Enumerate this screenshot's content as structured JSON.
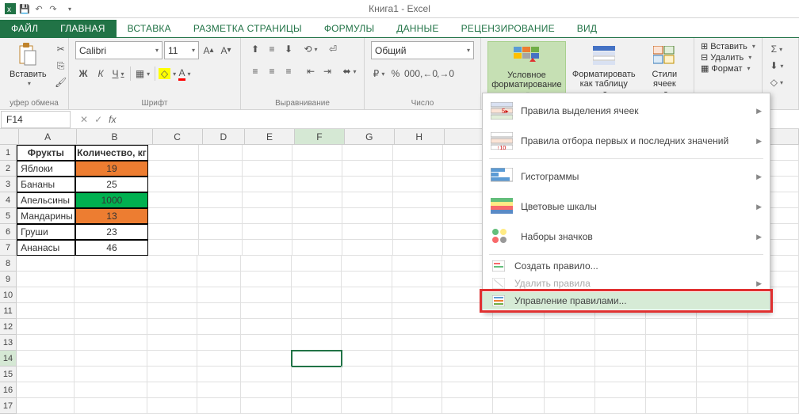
{
  "app_title": "Книга1 - Excel",
  "tabs": {
    "file": "ФАЙЛ",
    "home": "ГЛАВНАЯ",
    "insert": "ВСТАВКА",
    "layout": "РАЗМЕТКА СТРАНИЦЫ",
    "formulas": "ФОРМУЛЫ",
    "data": "ДАННЫЕ",
    "review": "РЕЦЕНЗИРОВАНИЕ",
    "view": "ВИД"
  },
  "ribbon": {
    "clipboard": {
      "paste": "Вставить",
      "label": "уфер обмена"
    },
    "font": {
      "name": "Calibri",
      "size": "11",
      "label": "Шрифт"
    },
    "alignment": {
      "label": "Выравнивание"
    },
    "number": {
      "format": "Общий",
      "label": "Число"
    },
    "styles": {
      "cond_format": "Условное\nформатирование",
      "format_table": "Форматировать\nкак таблицу",
      "cell_styles": "Стили\nячеек"
    },
    "cells": {
      "insert": "Вставить",
      "delete": "Удалить",
      "format": "Формат"
    }
  },
  "namebox": "F14",
  "columns": [
    "A",
    "B",
    "C",
    "D",
    "E",
    "F",
    "G",
    "H"
  ],
  "table": {
    "headers": [
      "Фрукты",
      "Количество, кг"
    ],
    "rows": [
      {
        "name": "Яблоки",
        "qty": "19",
        "color": "orange"
      },
      {
        "name": "Бананы",
        "qty": "25",
        "color": ""
      },
      {
        "name": "Апельсины",
        "qty": "1000",
        "color": "green"
      },
      {
        "name": "Мандарины",
        "qty": "13",
        "color": "orange"
      },
      {
        "name": "Груши",
        "qty": "23",
        "color": ""
      },
      {
        "name": "Ананасы",
        "qty": "46",
        "color": ""
      }
    ]
  },
  "dropdown": {
    "highlight_rules": "Правила выделения ячеек",
    "top_bottom": "Правила отбора первых и последних значений",
    "data_bars": "Гистограммы",
    "color_scales": "Цветовые шкалы",
    "icon_sets": "Наборы значков",
    "new_rule": "Создать правило...",
    "clear_rules": "Удалить правила",
    "manage_rules": "Управление правилами..."
  }
}
